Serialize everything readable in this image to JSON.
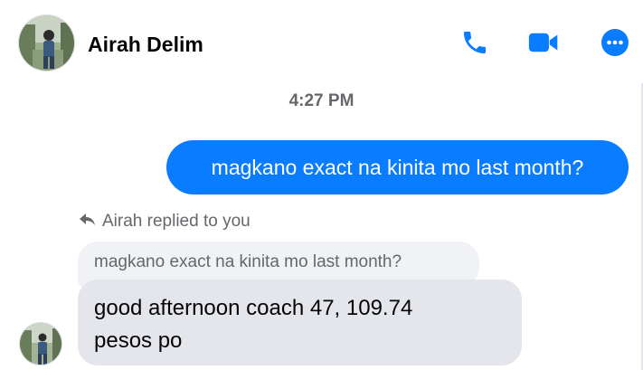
{
  "header": {
    "contact_name": "Airah Delim",
    "icons": {
      "phone": "phone-icon",
      "video": "video-camera-icon",
      "more": "more-options-icon"
    }
  },
  "conversation": {
    "timestamp": "4:27 PM",
    "outgoing_message": "magkano exact na kinita mo last month?",
    "reply_label": "Airah replied to you",
    "quoted_message": "magkano exact na kinita mo last month?",
    "incoming_message_line1": "good afternoon coach 47, 109.74",
    "incoming_message_line2": "pesos po"
  },
  "colors": {
    "accent": "#0a7cff",
    "outgoing_bubble": "#0a7cff",
    "incoming_bubble": "#e4e6eb",
    "quoted_bubble": "#f0f2f5",
    "secondary_text": "#65676b"
  }
}
